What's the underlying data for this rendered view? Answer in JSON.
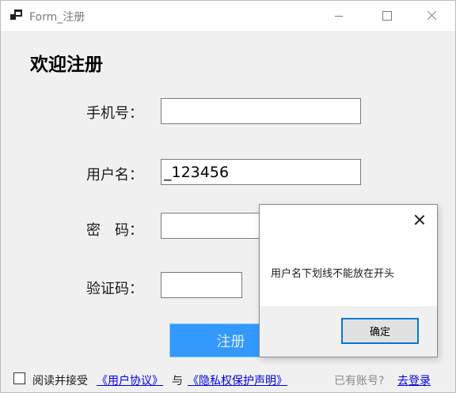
{
  "window": {
    "title": "Form_注册",
    "icon": "windows-app-icon",
    "controls": [
      "minimize-icon",
      "maximize-icon",
      "close-icon"
    ]
  },
  "form": {
    "heading": "欢迎注册",
    "phone": {
      "label": "手机号：",
      "value": ""
    },
    "username": {
      "label": "用户名：",
      "value": "_123456"
    },
    "password": {
      "label": "密　码：",
      "value": ""
    },
    "captcha": {
      "label": "验证码：",
      "value": ""
    },
    "register_label": "注册"
  },
  "footer": {
    "agree_checked": false,
    "agree_text": "阅读并接受",
    "user_agreement": "《用户协议》",
    "and_text": "与",
    "privacy_policy": "《隐私权保护声明》",
    "has_account": "已有账号?",
    "login_link": "去登录"
  },
  "dialog": {
    "message": "用户名下划线不能放在开头",
    "ok_label": "确定"
  },
  "colors": {
    "primary_button": "#3399ff",
    "link": "#0000ee",
    "dialog_ok_border": "#0078d7"
  }
}
